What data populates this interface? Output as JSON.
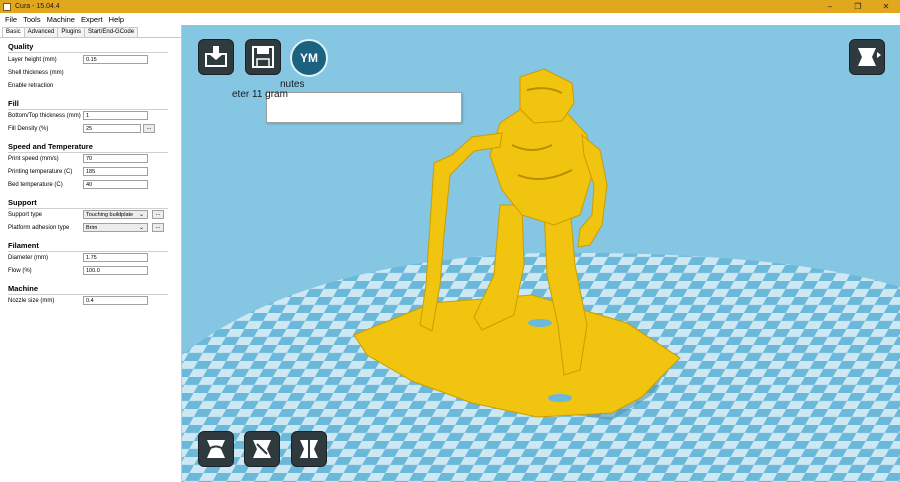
{
  "window": {
    "title": "Cura - 15.04.4",
    "controls": {
      "minimize": "–",
      "maximize": "❐",
      "close": "✕"
    }
  },
  "menu": [
    "File",
    "Tools",
    "Machine",
    "Expert",
    "Help"
  ],
  "tabs": [
    "Basic",
    "Advanced",
    "Plugins",
    "Start/End-GCode"
  ],
  "sections": {
    "quality": {
      "title": "Quality",
      "layer_height": {
        "label": "Layer height (mm)",
        "value": "0.15"
      },
      "shell_thickness": {
        "label": "Shell thickness (mm)"
      },
      "enable_retraction": {
        "label": "Enable retraction"
      }
    },
    "fill": {
      "title": "Fill",
      "bottom_top": {
        "label": "Bottom/Top thickness (mm)",
        "value": "1"
      },
      "fill_density": {
        "label": "Fill Density (%)",
        "value": "25",
        "more": "..."
      }
    },
    "speed": {
      "title": "Speed and Temperature",
      "print_speed": {
        "label": "Print speed (mm/s)",
        "value": "70"
      },
      "print_temp": {
        "label": "Printing temperature (C)",
        "value": "185"
      },
      "bed_temp": {
        "label": "Bed temperature (C)",
        "value": "40"
      }
    },
    "support": {
      "title": "Support",
      "support_type": {
        "label": "Support type",
        "value": "Touching buildplate",
        "more": "..."
      },
      "adhesion": {
        "label": "Platform adhesion type",
        "value": "Brim",
        "more": "..."
      }
    },
    "filament": {
      "title": "Filament",
      "diameter": {
        "label": "Diameter (mm)",
        "value": "1.75"
      },
      "flow": {
        "label": "Flow (%)",
        "value": "100.0"
      }
    },
    "machine": {
      "title": "Machine",
      "nozzle": {
        "label": "Nozzle size (mm)",
        "value": "0.4"
      }
    }
  },
  "viewport": {
    "ym_label": "YM",
    "print_info_line1": "nutes",
    "print_info_line2": "eter 11 gram"
  },
  "icons": [
    "load-icon",
    "save-icon",
    "ym-icon",
    "view-mode-icon",
    "rotate-icon",
    "scale-icon",
    "mirror-icon"
  ],
  "colors": {
    "titlebar": "#e2a81d",
    "viewport_bg": "#85c7e3",
    "model": "#f1c40f",
    "platform_light": "#cde8f2",
    "platform_dark": "#6ab8da"
  }
}
